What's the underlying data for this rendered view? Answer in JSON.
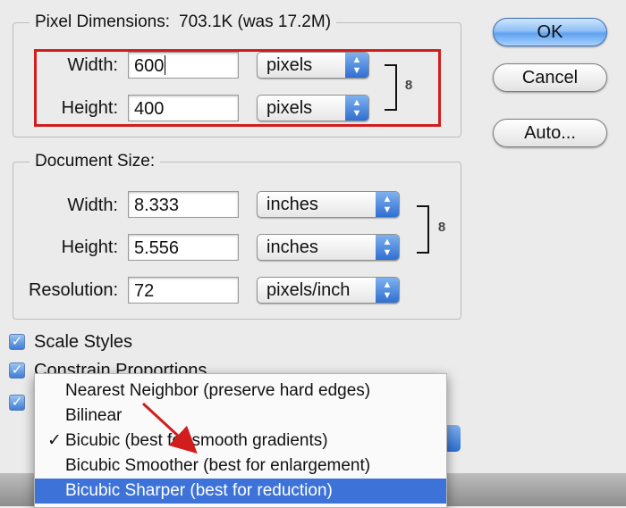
{
  "pixel_dimensions": {
    "title": "Pixel Dimensions:",
    "size_text": "703.1K (was 17.2M)",
    "width": {
      "label": "Width:",
      "value": "600",
      "unit": "pixels"
    },
    "height": {
      "label": "Height:",
      "value": "400",
      "unit": "pixels"
    }
  },
  "document_size": {
    "title": "Document Size:",
    "width": {
      "label": "Width:",
      "value": "8.333",
      "unit": "inches"
    },
    "height": {
      "label": "Height:",
      "value": "5.556",
      "unit": "inches"
    },
    "resolution": {
      "label": "Resolution:",
      "value": "72",
      "unit": "pixels/inch"
    }
  },
  "buttons": {
    "ok": "OK",
    "cancel": "Cancel",
    "auto": "Auto..."
  },
  "checkboxes": {
    "scale_styles": "Scale Styles",
    "constrain_proportions": "Constrain Proportions"
  },
  "resample_menu": {
    "items": [
      {
        "label": "Nearest Neighbor (preserve hard edges)",
        "checked": false
      },
      {
        "label": "Bilinear",
        "checked": false
      },
      {
        "label": "Bicubic (best for smooth gradients)",
        "checked": true
      },
      {
        "label": "Bicubic Smoother (best for enlargement)",
        "checked": false
      },
      {
        "label": "Bicubic Sharper (best for reduction)",
        "checked": false,
        "highlighted": true
      }
    ],
    "check_mark": "✓"
  },
  "icons": {
    "stepper": "▴▾",
    "checkmark": "✓",
    "link": "8"
  },
  "colors": {
    "highlight_red": "#d21d1d",
    "selection_blue": "#3d73d8",
    "default_button_blue": "#5fa2ef"
  }
}
